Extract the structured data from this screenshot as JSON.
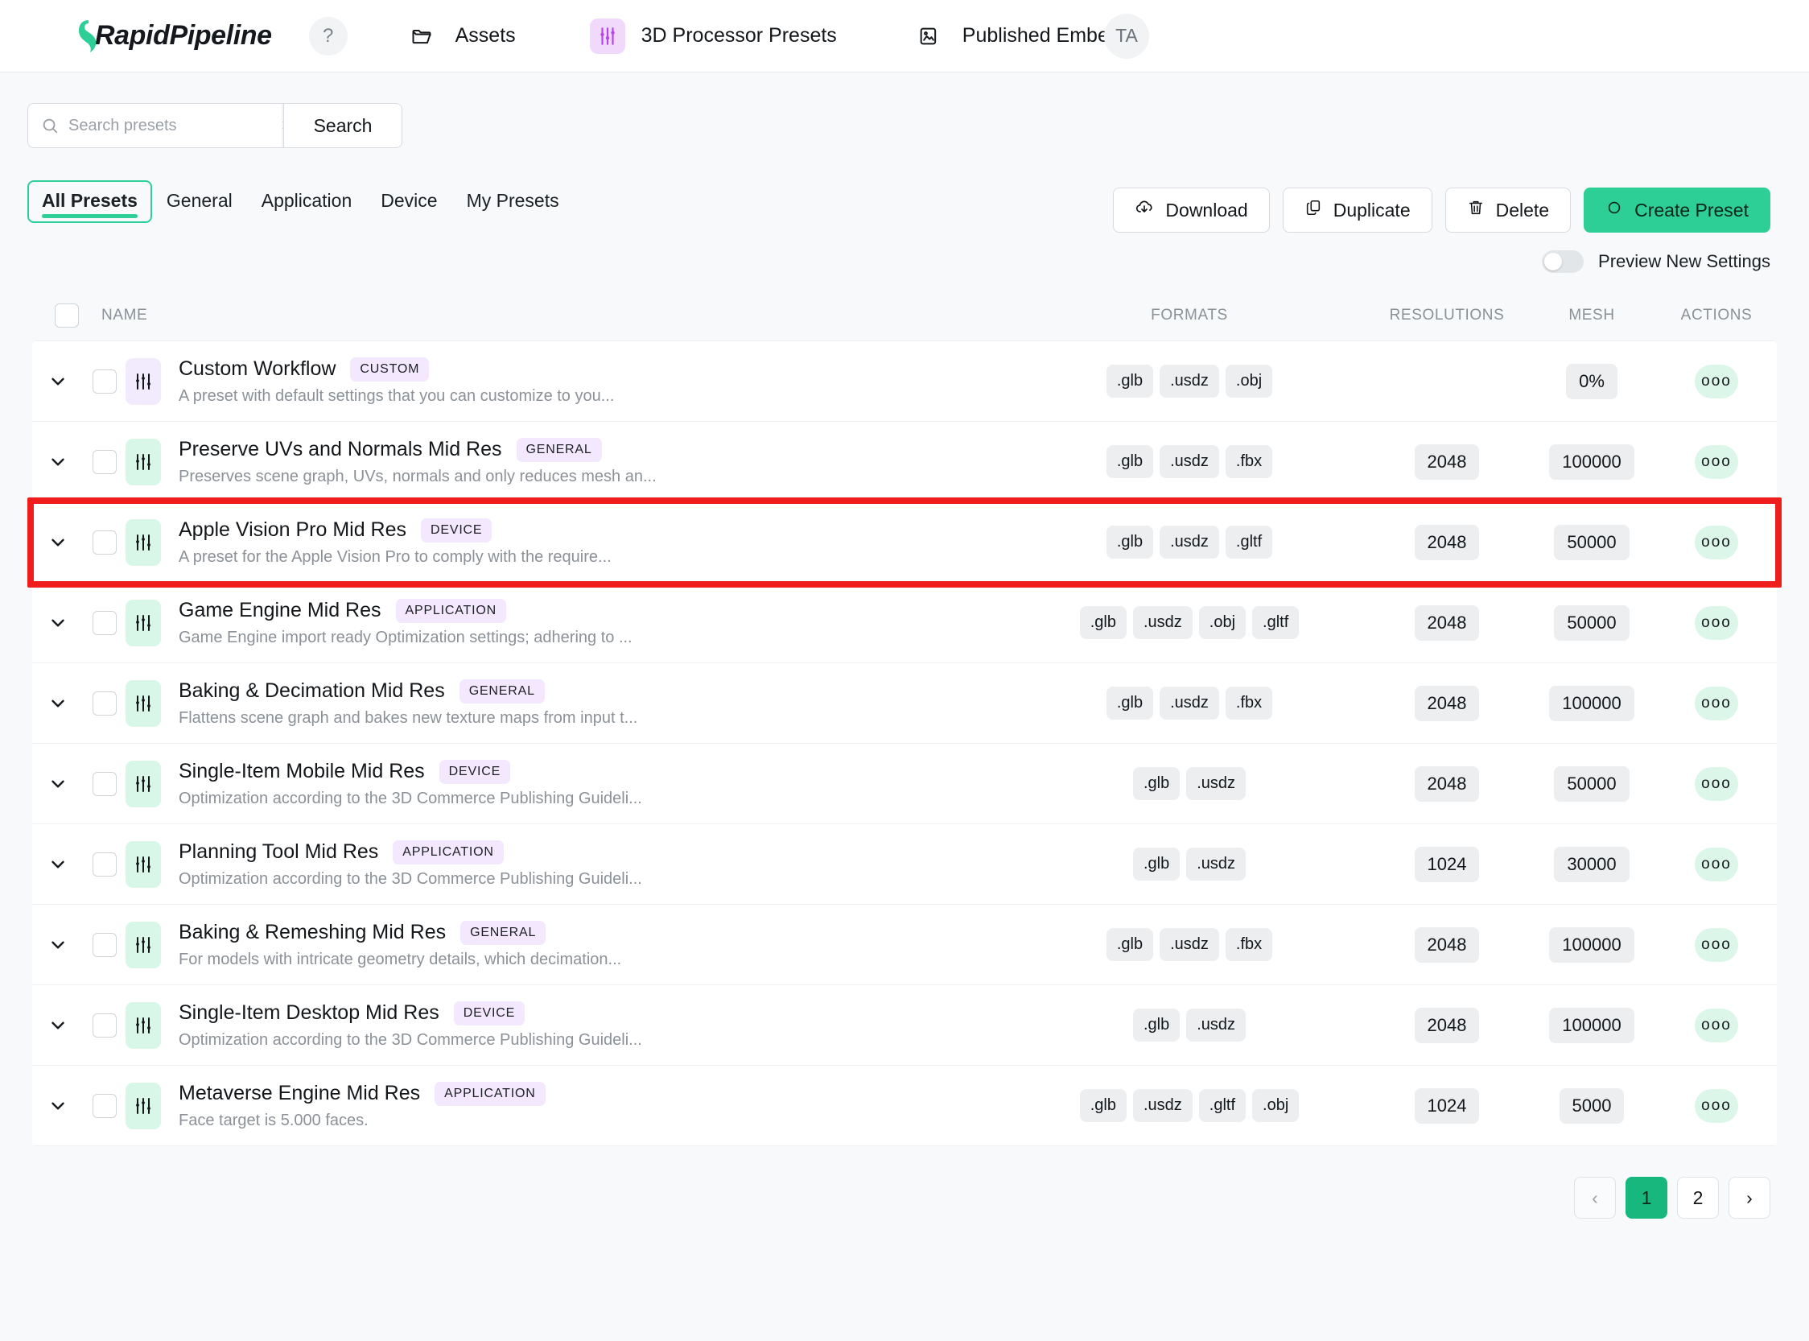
{
  "brand": {
    "name": "RapidPipeline",
    "help_label": "?"
  },
  "topnav": {
    "items": [
      {
        "label": "Assets",
        "icon": "folder-icon"
      },
      {
        "label": "3D Processor Presets",
        "icon": "sliders-icon"
      },
      {
        "label": "Published Embeds",
        "icon": "image-frame-icon"
      }
    ],
    "avatar_initials": "TA"
  },
  "search": {
    "placeholder": "Search presets",
    "value": "",
    "clear_label": "×",
    "button_label": "Search"
  },
  "tabs": [
    {
      "label": "All Presets",
      "active": true
    },
    {
      "label": "General",
      "active": false
    },
    {
      "label": "Application",
      "active": false
    },
    {
      "label": "Device",
      "active": false
    },
    {
      "label": "My Presets",
      "active": false
    }
  ],
  "toolbar": {
    "download_label": "Download",
    "duplicate_label": "Duplicate",
    "delete_label": "Delete",
    "create_label": "Create Preset",
    "preview_toggle_label": "Preview New Settings",
    "preview_toggle_on": false
  },
  "table": {
    "columns": [
      "NAME",
      "FORMATS",
      "RESOLUTIONS",
      "MESH",
      "ACTIONS"
    ],
    "actions_glyph": "ooo",
    "rows": [
      {
        "name": "Custom Workflow",
        "badge": "CUSTOM",
        "description": "A preset with default settings that you can customize to you...",
        "icon_theme": "purple",
        "formats": [
          ".glb",
          ".usdz",
          ".obj"
        ],
        "resolution": "",
        "mesh": "0%"
      },
      {
        "name": "Preserve UVs and Normals Mid Res",
        "badge": "GENERAL",
        "description": "Preserves scene graph, UVs, normals and only reduces mesh an...",
        "icon_theme": "green",
        "formats": [
          ".glb",
          ".usdz",
          ".fbx"
        ],
        "resolution": "2048",
        "mesh": "100000"
      },
      {
        "name": "Apple Vision Pro Mid Res",
        "badge": "DEVICE",
        "description": "A preset for the Apple Vision Pro to comply with the require...",
        "icon_theme": "green",
        "formats": [
          ".glb",
          ".usdz",
          ".gltf"
        ],
        "resolution": "2048",
        "mesh": "50000",
        "highlighted": true
      },
      {
        "name": "Game Engine Mid Res",
        "badge": "APPLICATION",
        "description": "Game Engine import ready Optimization settings; adhering to ...",
        "icon_theme": "green",
        "formats": [
          ".glb",
          ".usdz",
          ".obj",
          ".gltf"
        ],
        "resolution": "2048",
        "mesh": "50000"
      },
      {
        "name": "Baking & Decimation Mid Res",
        "badge": "GENERAL",
        "description": "Flattens scene graph and bakes new texture maps from input t...",
        "icon_theme": "green",
        "formats": [
          ".glb",
          ".usdz",
          ".fbx"
        ],
        "resolution": "2048",
        "mesh": "100000"
      },
      {
        "name": "Single-Item Mobile Mid Res",
        "badge": "DEVICE",
        "description": "Optimization according to the 3D Commerce Publishing Guideli...",
        "icon_theme": "green",
        "formats": [
          ".glb",
          ".usdz"
        ],
        "resolution": "2048",
        "mesh": "50000"
      },
      {
        "name": "Planning Tool Mid Res",
        "badge": "APPLICATION",
        "description": "Optimization according to the 3D Commerce Publishing Guideli...",
        "icon_theme": "green",
        "formats": [
          ".glb",
          ".usdz"
        ],
        "resolution": "1024",
        "mesh": "30000"
      },
      {
        "name": "Baking & Remeshing Mid Res",
        "badge": "GENERAL",
        "description": "For models with intricate geometry details, which decimation...",
        "icon_theme": "green",
        "formats": [
          ".glb",
          ".usdz",
          ".fbx"
        ],
        "resolution": "2048",
        "mesh": "100000"
      },
      {
        "name": "Single-Item Desktop Mid Res",
        "badge": "DEVICE",
        "description": "Optimization according to the 3D Commerce Publishing Guideli...",
        "icon_theme": "green",
        "formats": [
          ".glb",
          ".usdz"
        ],
        "resolution": "2048",
        "mesh": "100000"
      },
      {
        "name": "Metaverse Engine Mid Res",
        "badge": "APPLICATION",
        "description": "Face target is 5.000 faces.",
        "icon_theme": "green",
        "formats": [
          ".glb",
          ".usdz",
          ".gltf",
          ".obj"
        ],
        "resolution": "1024",
        "mesh": "5000"
      }
    ]
  },
  "pagination": {
    "prev_label": "‹",
    "next_label": "›",
    "pages": [
      "1",
      "2"
    ],
    "current": "1"
  },
  "colors": {
    "accent_green": "#2ecf96",
    "page_active_green": "#17b77d",
    "badge_purple": "#f3e8fd",
    "icon_green_bg": "#d9f7e9",
    "icon_purple_bg": "#f1ebfd",
    "highlight_red": "#f01d1d",
    "chip_grey": "#eceef0"
  }
}
